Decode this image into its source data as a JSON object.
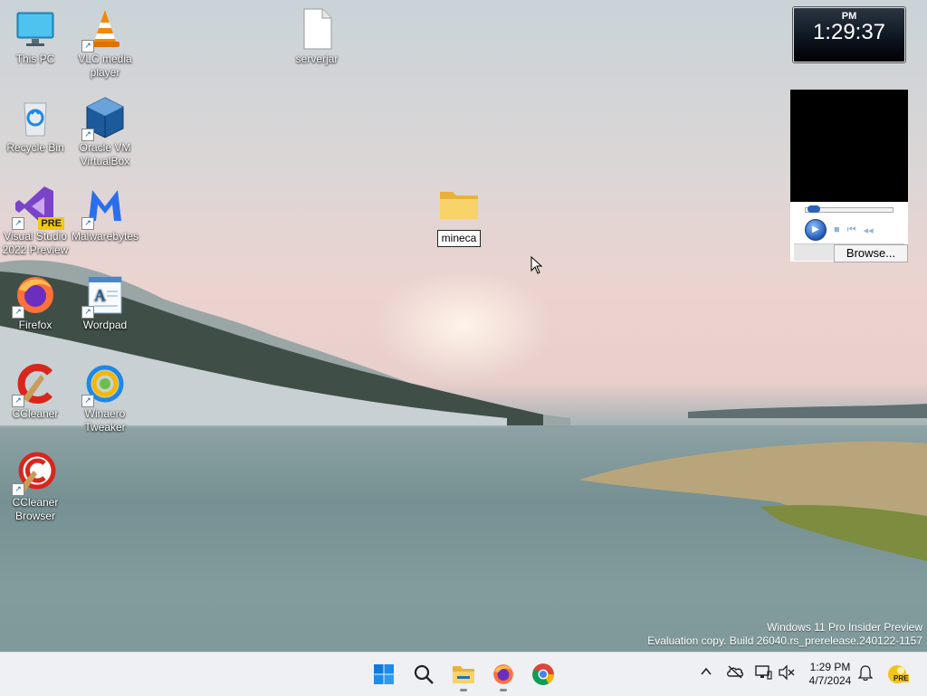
{
  "desktop": {
    "icons": [
      {
        "label": "This PC",
        "icon": "monitor-icon"
      },
      {
        "label": "VLC media player",
        "icon": "vlc-cone-icon"
      },
      {
        "label": "Recycle Bin",
        "icon": "recycle-bin-icon"
      },
      {
        "label": "Oracle VM VirtualBox",
        "icon": "virtualbox-icon"
      },
      {
        "label": "Visual Studio 2022 Preview",
        "icon": "visual-studio-icon"
      },
      {
        "label": "Malwarebytes",
        "icon": "malwarebytes-icon"
      },
      {
        "label": "Firefox",
        "icon": "firefox-icon"
      },
      {
        "label": "Wordpad",
        "icon": "wordpad-icon"
      },
      {
        "label": "CCleaner",
        "icon": "ccleaner-icon"
      },
      {
        "label": "Winaero Tweaker",
        "icon": "winaero-icon"
      },
      {
        "label": "CCleaner Browser",
        "icon": "ccleaner-browser-icon"
      },
      {
        "label": "serverjar",
        "icon": "file-icon"
      }
    ],
    "new_folder": {
      "rename_value": "mineca",
      "icon": "folder-icon"
    },
    "vs_badge": "PRE"
  },
  "clock_widget": {
    "ampm": "PM",
    "time": "1:29:37"
  },
  "media_widget": {
    "browse_label": "Browse...",
    "seek_fraction": 0.05
  },
  "watermark": {
    "line1": "Windows 11 Pro Insider Preview",
    "line2": "Evaluation copy. Build 26040.rs_prerelease.240122-1157"
  },
  "taskbar": {
    "apps": [
      {
        "name": "Start",
        "icon": "windows-start-icon"
      },
      {
        "name": "Search",
        "icon": "search-icon"
      },
      {
        "name": "File Explorer",
        "icon": "file-explorer-icon"
      },
      {
        "name": "Firefox",
        "icon": "firefox-icon"
      },
      {
        "name": "Chrome",
        "icon": "chrome-icon"
      }
    ],
    "tray": {
      "time": "1:29 PM",
      "date": "4/7/2024",
      "dev_badge": "PRE"
    }
  }
}
